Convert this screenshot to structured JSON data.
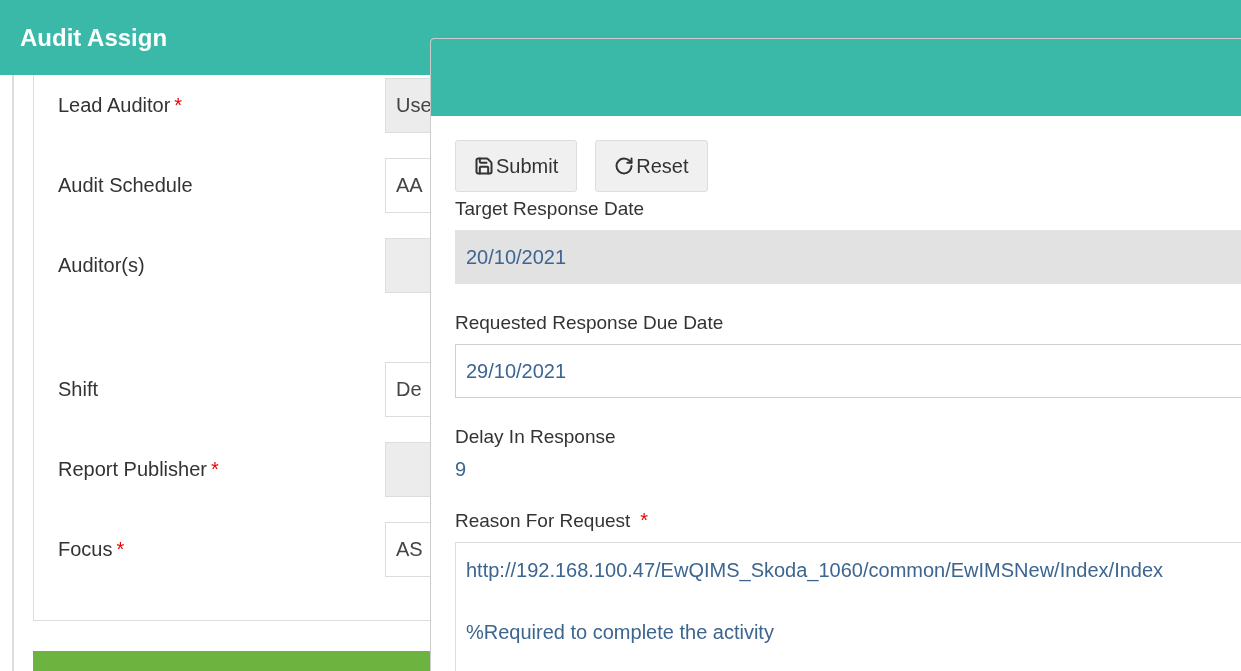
{
  "page": {
    "title": "Audit Assign"
  },
  "form_fields": [
    {
      "kind": "single",
      "label": "Lead Auditor",
      "required_mark": "*",
      "value": "Use",
      "disabled": true
    },
    {
      "kind": "single",
      "label": "Audit Schedule",
      "value": "AA",
      "disabled": false
    },
    {
      "kind": "multi",
      "label": "Auditor(s)",
      "disabled": true
    },
    {
      "kind": "single",
      "label": "Shift",
      "value": "De",
      "disabled": false
    },
    {
      "kind": "single",
      "label": "Report Publisher",
      "required_mark": "*",
      "disabled": true
    },
    {
      "kind": "single",
      "label": "Focus",
      "required_mark": "*",
      "value": "AS",
      "disabled": false
    }
  ],
  "modal": {
    "buttons": [
      {
        "label": "Submit"
      },
      {
        "label": "Reset"
      }
    ],
    "fields": [
      {
        "kind": "input",
        "label": "Target Response Date",
        "value": "20/10/2021",
        "disabled": true
      },
      {
        "kind": "input",
        "label": "Requested Response Due Date",
        "value": "29/10/2021",
        "disabled": false
      },
      {
        "kind": "text",
        "label": "Delay In Response",
        "value": "9"
      },
      {
        "kind": "textarea",
        "label": "Reason For Request",
        "required_mark": "*",
        "paragraphs": [
          "http://192.168.100.47/EwQIMS_Skoda_1060/common/EwIMSNew/Index/Index",
          "%Required to complete the activity"
        ]
      }
    ]
  }
}
